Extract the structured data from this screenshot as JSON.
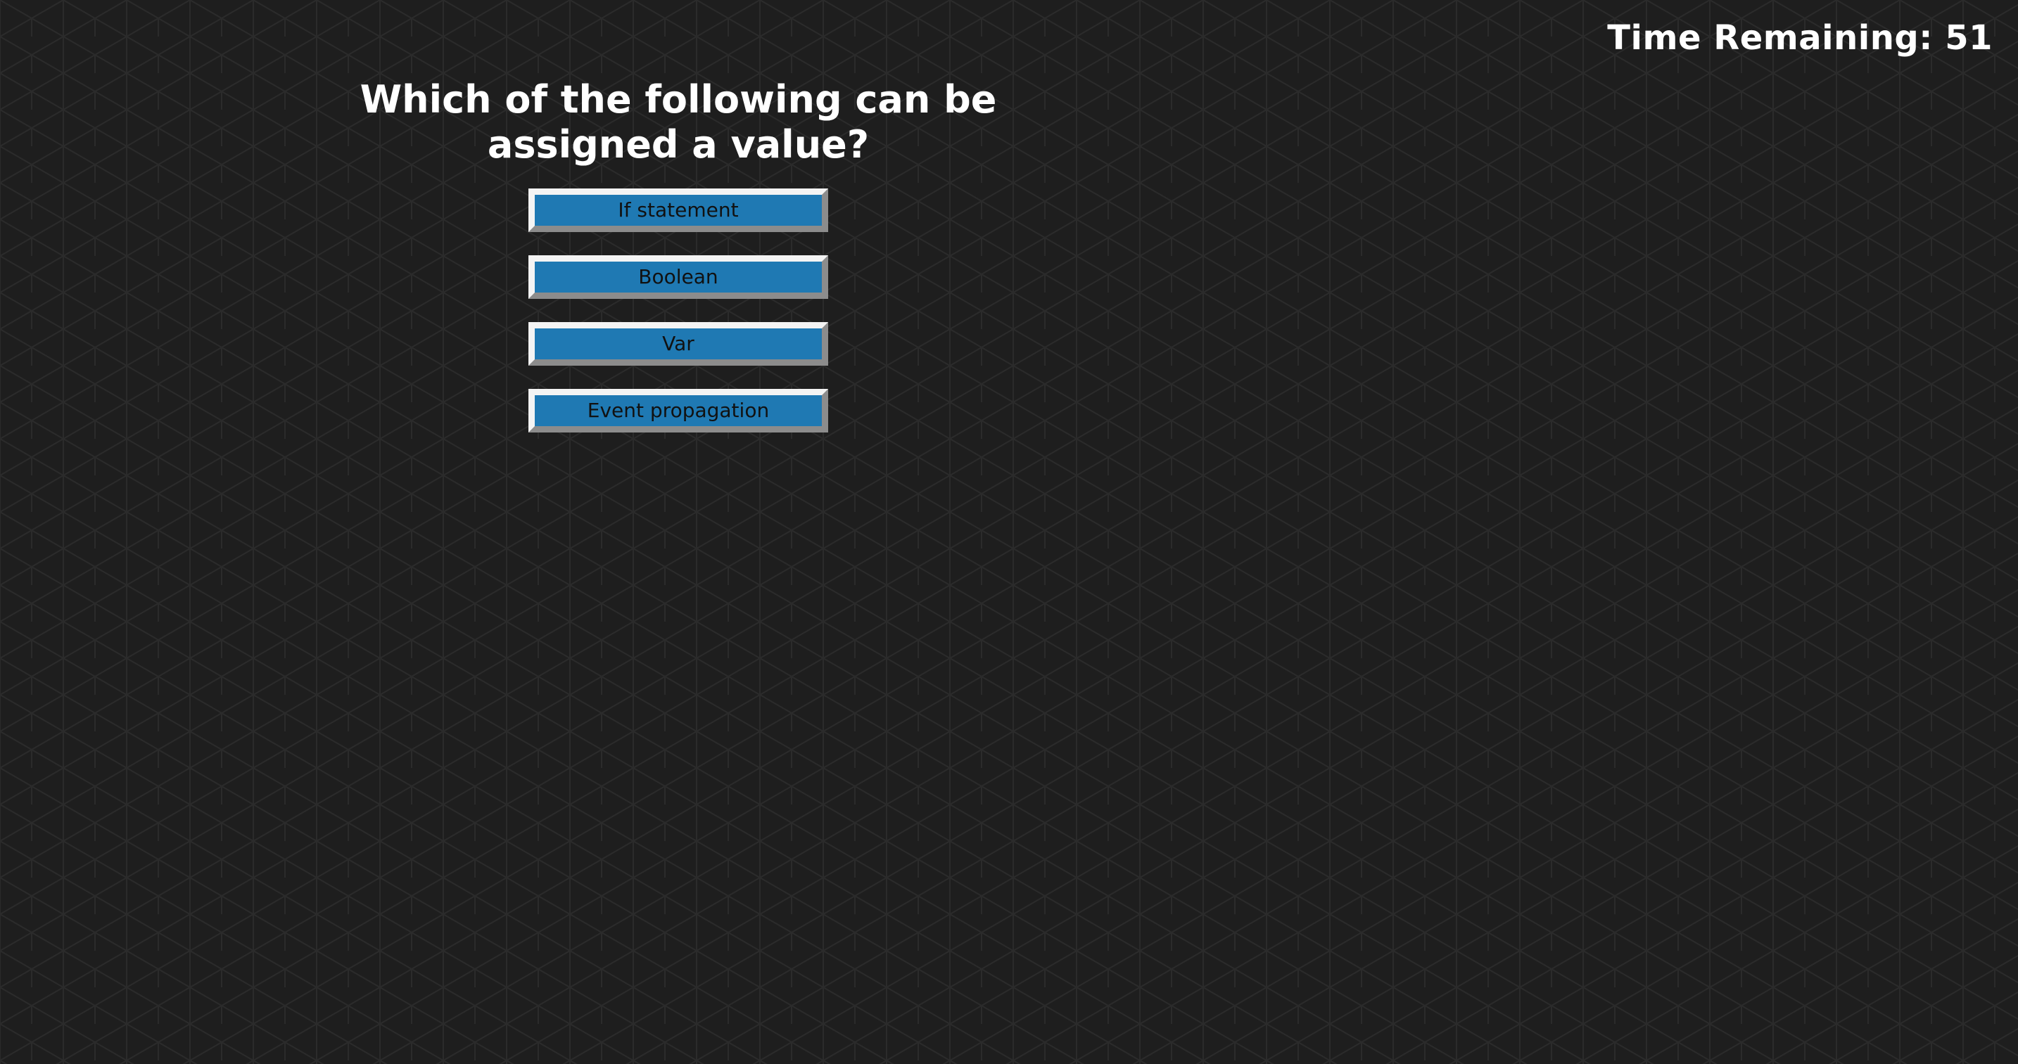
{
  "timer": {
    "text": "Time Remaining: 51"
  },
  "quiz": {
    "question": "Which of the following can be assigned a value?",
    "answers": [
      {
        "label": "If statement"
      },
      {
        "label": "Boolean"
      },
      {
        "label": "Var"
      },
      {
        "label": "Event propagation"
      }
    ]
  },
  "colors": {
    "background": "#1e1e1e",
    "pattern_line": "#2b2b2b",
    "button_fill": "#1f79b3",
    "button_border_light": "#f4f4f4",
    "button_border_dark": "#8c8c8c",
    "text_light": "#ffffff",
    "text_dark": "#111111"
  }
}
